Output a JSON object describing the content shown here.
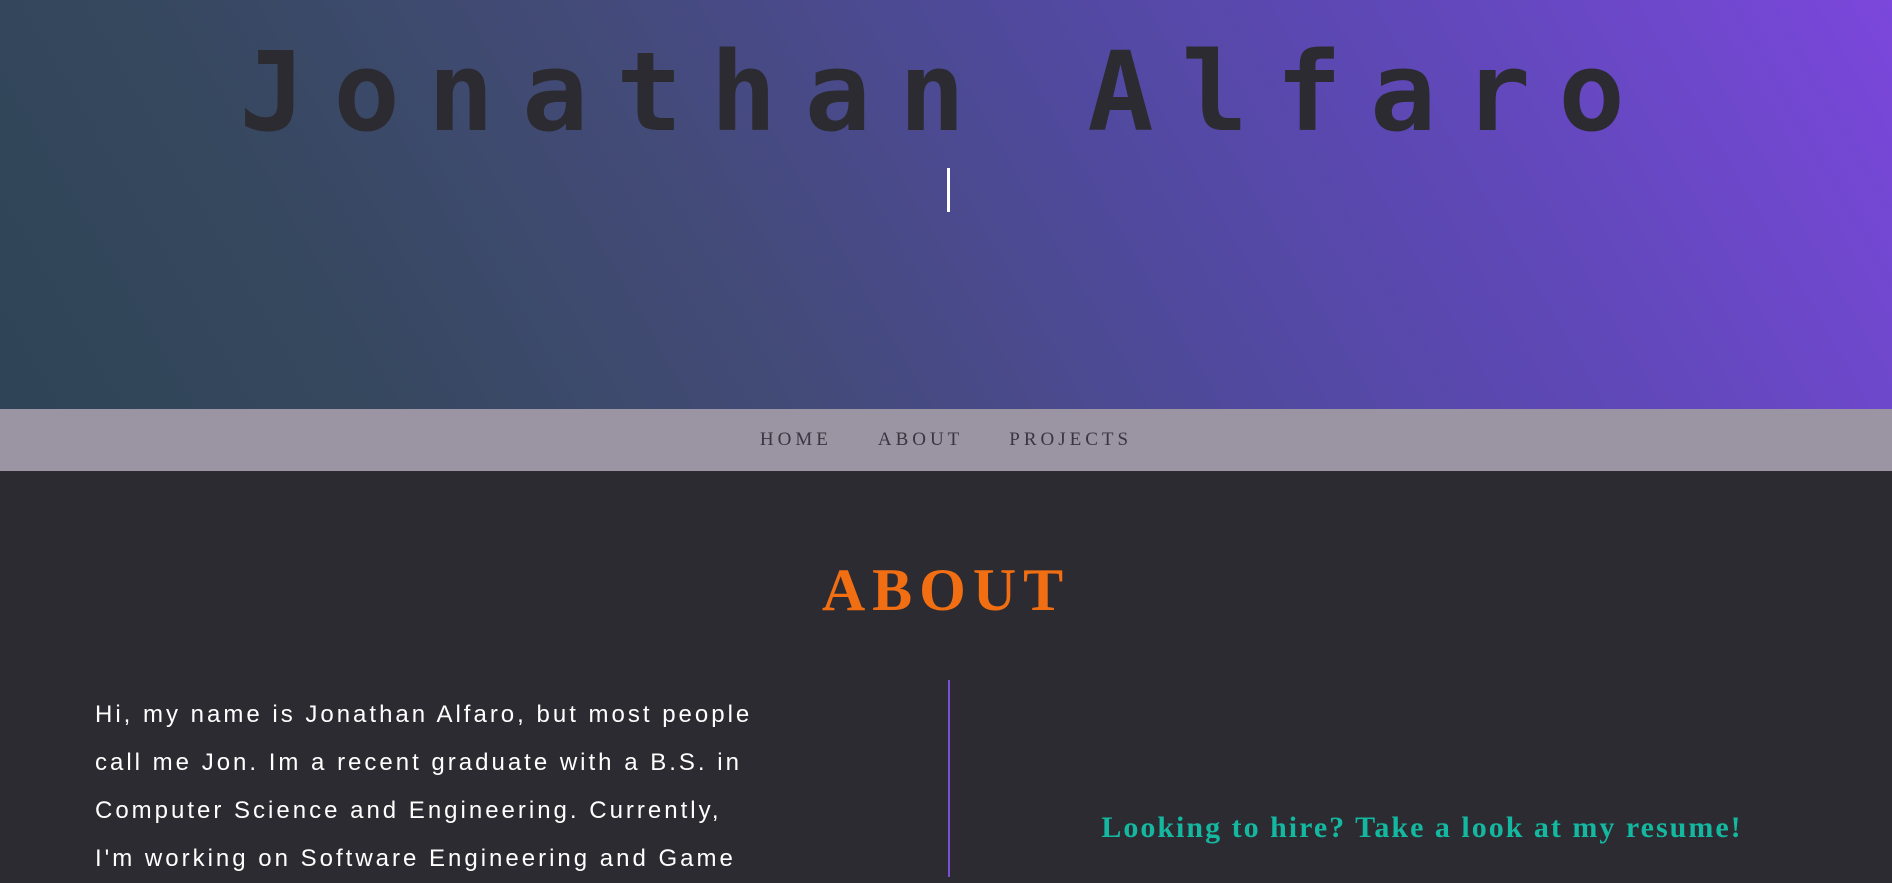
{
  "header": {
    "title": "Jonathan Alfaro"
  },
  "nav": {
    "items": [
      {
        "label": "HOME"
      },
      {
        "label": "ABOUT"
      },
      {
        "label": "PROJECTS"
      }
    ]
  },
  "about": {
    "heading": "ABOUT",
    "bio_lines": [
      "Hi, my name is Jonathan Alfaro, but most people",
      "call me Jon. Im a recent graduate with a B.S. in",
      "Computer Science and Engineering. Currently,",
      "I'm working on Software Engineering and Game"
    ],
    "resume_link": "Looking to hire? Take a look at my resume!"
  },
  "colors": {
    "accent_orange": "#f26e12",
    "accent_teal": "#14b8a0",
    "divider_purple": "#7a4fd6",
    "background": "#2c2b31",
    "nav_background": "#9b94a2"
  }
}
